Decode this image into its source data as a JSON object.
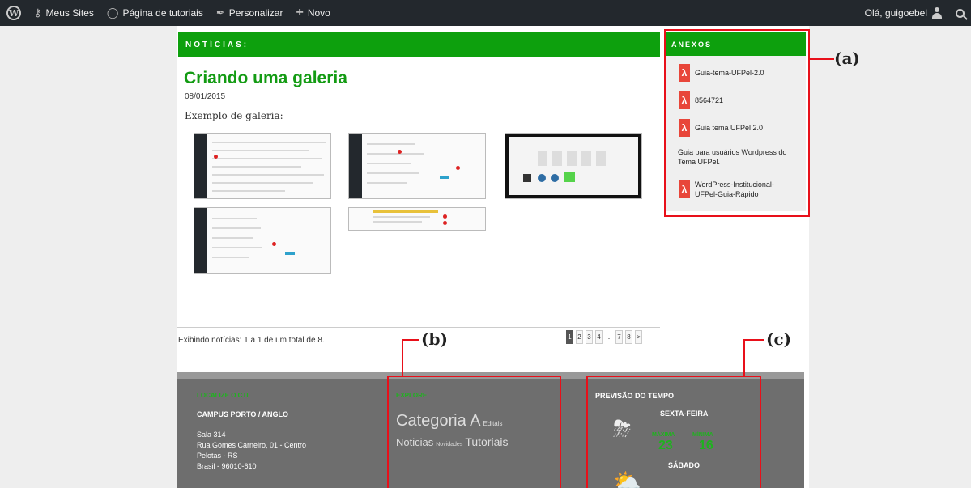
{
  "adminbar": {
    "items": [
      {
        "icon": "wordpress-logo-icon",
        "label": ""
      },
      {
        "icon": "key-icon",
        "label": "Meus Sites"
      },
      {
        "icon": "dashboard-icon",
        "label": "Página de tutoriais"
      },
      {
        "icon": "brush-icon",
        "label": "Personalizar"
      },
      {
        "icon": "plus-icon",
        "label": "Novo"
      }
    ],
    "greeting": "Olá, guigoebel"
  },
  "main": {
    "section_header": "NOTÍCIAS:",
    "post": {
      "title": "Criando uma galeria",
      "date": "08/01/2015",
      "excerpt": "Exemplo de galeria:"
    },
    "pagination": {
      "info": "Exibindo notícias: 1 a 1 de um total de 8.",
      "pages": [
        "1",
        "2",
        "3",
        "4",
        "...",
        "7",
        "8",
        ">"
      ],
      "current": "1"
    }
  },
  "sidebar": {
    "header": "ANEXOS",
    "attachments": [
      {
        "label": "Guia-tema-UFPel-2.0"
      },
      {
        "label": "8564721"
      },
      {
        "label": "Guia tema UFPel 2.0"
      },
      {
        "label": "WordPress-Institucional-UFPel-Guia-Rápido"
      }
    ],
    "description": "Guia para usuários Wordpress do Tema UFPel."
  },
  "footer": {
    "location": {
      "header": "LOCALIZE O CTI",
      "campus": "CAMPUS PORTO / ANGLO",
      "lines": [
        "Sala 314",
        "Rua Gomes Carneiro, 01 - Centro",
        "Pelotas - RS",
        "Brasil - 96010-610"
      ]
    },
    "explore": {
      "header": "EXPLORE",
      "tags": [
        "Categoria A",
        "Editais",
        "Noticias",
        "Novidades",
        "Tutoriais"
      ]
    },
    "weather": {
      "header": "PREVISÃO DO TEMPO",
      "days": [
        {
          "name": "SEXTA-FEIRA",
          "max_label": "MÁXIMA",
          "min_label": "MÍNIMA",
          "max": "23",
          "min": "16",
          "icon": "storm-cloud-icon"
        },
        {
          "name": "SÁBADO",
          "icon": "sun-cloud-icon"
        }
      ]
    }
  },
  "annotations": [
    "(a)",
    "(b)",
    "(c)"
  ]
}
